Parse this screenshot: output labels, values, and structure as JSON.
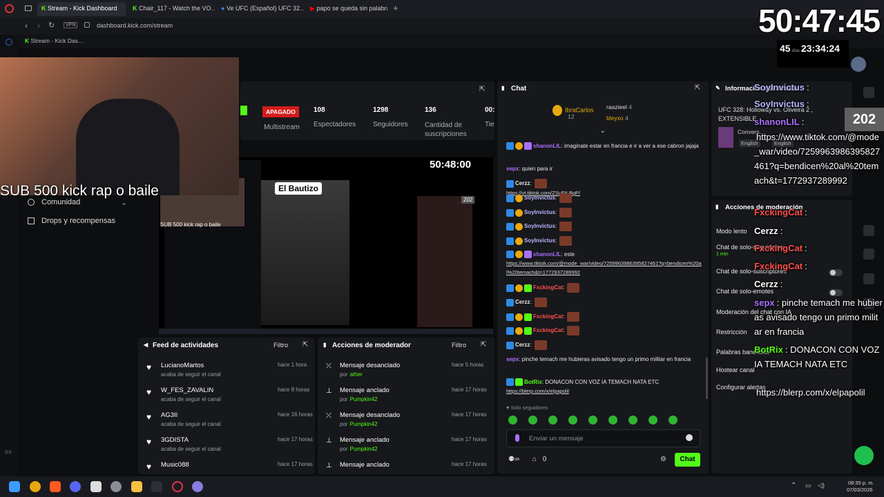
{
  "browser": {
    "tabs": [
      "Stream - Kick Dashboard",
      "Chair_117 - Watch the VO…",
      "Ve UFC (Español) UFC 32…",
      "papo se queda sin palabra…"
    ],
    "url": "dashboard.kick.com/stream",
    "vpn": "VPN",
    "bookmark": "Stream - Kick Das…"
  },
  "overlay": {
    "timer_big": "50:47:45",
    "timer_small": "45",
    "timer_small_unit": "días",
    "timer_small_clock": "23:34:24",
    "sub_text": "SUB 500 kick  rap o  baile",
    "preview_timer": "50:48:00",
    "preview_title": "El Bautizo",
    "preview_sub": "SUB 500 kick  rap o  baile",
    "preview_count": "202",
    "viewer_count": "202",
    "overlay_chat": [
      {
        "user": "SoyInvictus",
        "text": ":"
      },
      {
        "user": "SoyInvictus",
        "text": ":"
      },
      {
        "user": "shanonLIL",
        "text": ":"
      },
      {
        "user": "",
        "text": "https://www.tiktok.com/@mode_war/video/7259963986395827461?q=bendicen%20al%20temach&t=1772937289992"
      },
      {
        "user": "FxckingCat",
        "text": ":"
      },
      {
        "user": "Cerzz",
        "text": ":"
      },
      {
        "user": "FxckingCat",
        "text": ":"
      },
      {
        "user": "FxckingCat",
        "text": ":"
      },
      {
        "user": "Cerzz",
        "text": ":"
      },
      {
        "user": "sepx",
        "text": ": pinche temach me hubieras avisado tengo un primo militar en francia"
      },
      {
        "user": "BotRix",
        "text": ": DONACON CON VOZ IA TEMACH NATA ETC"
      },
      {
        "user": "",
        "text": "https://blerp.com/x/elpapolil"
      }
    ]
  },
  "stats": {
    "status": "APAGADO",
    "status_sub": "Multistream",
    "items": [
      {
        "num": "108",
        "label": "Espectadores"
      },
      {
        "num": "1298",
        "label": "Seguidores"
      },
      {
        "num": "136",
        "label": "Cantidad de suscripciones"
      },
      {
        "num": "00:",
        "label": "Tie… ve…"
      }
    ]
  },
  "sidebar": {
    "items": [
      "Comunidad",
      "Drops y recompensas"
    ]
  },
  "feed": {
    "title": "Feed de actividades",
    "filter": "Filtro",
    "items": [
      {
        "user": "LucianoMartos",
        "time": "hace 1 hora",
        "desc": "acaba de seguir el canal"
      },
      {
        "user": "W_FES_ZAVALIN",
        "time": "hace 8 horas",
        "desc": "acaba de seguir el canal"
      },
      {
        "user": "AG3II",
        "time": "hace 16 horas",
        "desc": "acaba de seguir el canal"
      },
      {
        "user": "3GDISTA",
        "time": "hace 17 horas",
        "desc": "acaba de seguir el canal"
      },
      {
        "user": "Music088",
        "time": "hace 17 horas",
        "desc": ""
      }
    ]
  },
  "modactions": {
    "title": "Acciones de moderador",
    "filter": "Filtro",
    "items": [
      {
        "action": "Mensaje desanclado",
        "time": "hace 5 horas",
        "by": "por",
        "who": "ather"
      },
      {
        "action": "Mensaje anclado",
        "time": "hace 17 horas",
        "by": "por",
        "who": "Pumpkin42"
      },
      {
        "action": "Mensaje desanclado",
        "time": "hace 17 horas",
        "by": "por",
        "who": "Pumpkin42"
      },
      {
        "action": "Mensaje anclado",
        "time": "hace 17 horas",
        "by": "por",
        "who": "Pumpkin42"
      },
      {
        "action": "Mensaje anclado",
        "time": "hace 17 horas",
        "by": "",
        "who": ""
      }
    ]
  },
  "chat": {
    "title": "Chat",
    "leaders": [
      {
        "name": "IbraCarlos",
        "count": "12"
      },
      {
        "name": "raazieel",
        "count": "4"
      },
      {
        "name": "bleyxo",
        "count": "4"
      }
    ],
    "messages": [
      {
        "user": "shanonLIL",
        "text": ": imaginate estar en francia e ir a ver a ese cabron jajaja"
      },
      {
        "user": "sepx",
        "text": ": quien para ir"
      },
      {
        "user": "Cerzz",
        "text": ":",
        "link": "https://vt.tiktok.com/ZSuFtLBgP/"
      },
      {
        "user": "SoyInvictus",
        "text": ":"
      },
      {
        "user": "SoyInvictus",
        "text": ":"
      },
      {
        "user": "SoyInvictus",
        "text": ":"
      },
      {
        "user": "SoyInvictus",
        "text": ":"
      },
      {
        "user": "shanonLIL",
        "text": ": este",
        "link": "https://www.tiktok.com/@mode_war/video/7259963986395827461?q=bendicen%20al%20temach&t=1772937289992"
      },
      {
        "user": "FxckingCat",
        "text": ":"
      },
      {
        "user": "Cerzz",
        "text": ":"
      },
      {
        "user": "FxckingCat",
        "text": ":"
      },
      {
        "user": "FxckingCat",
        "text": ":"
      },
      {
        "user": "Cerzz",
        "text": ":"
      },
      {
        "user": "sepx",
        "text": ": pinche temach me hubieras avisado tengo un primo militar en francia"
      },
      {
        "user": "BotRix",
        "text": ": DONACON CON VOZ IA TEMACH NATA ETC",
        "link": "https://blerp.com/x/elpapolil"
      }
    ],
    "followers_only": "Solo seguidores",
    "input_placeholder": "Enviar un mensaje",
    "points": "0",
    "send": "Chat"
  },
  "streaminfo": {
    "title": "Información del stream",
    "stream_title": "UFC 328: Holloway vs. Oliveira 2 ,",
    "ext": "EXTENSIBLE",
    "conv": "Convers…",
    "langs": [
      "English",
      "English"
    ]
  },
  "modpanel": {
    "title": "Acciones de moderación",
    "items": [
      "Modo lento",
      "Chat de solo-seguidores",
      "Chat de solo-suscriptores",
      "Chat de solo-emotes",
      "Moderación del chat con IA",
      "Restricción",
      "Palabras baneadas",
      "Hostear canal",
      "Configurar alertas"
    ],
    "slow_value": "1 min"
  },
  "taskbar": {
    "time": "08:35 p. m.",
    "date": "07/03/2026"
  }
}
